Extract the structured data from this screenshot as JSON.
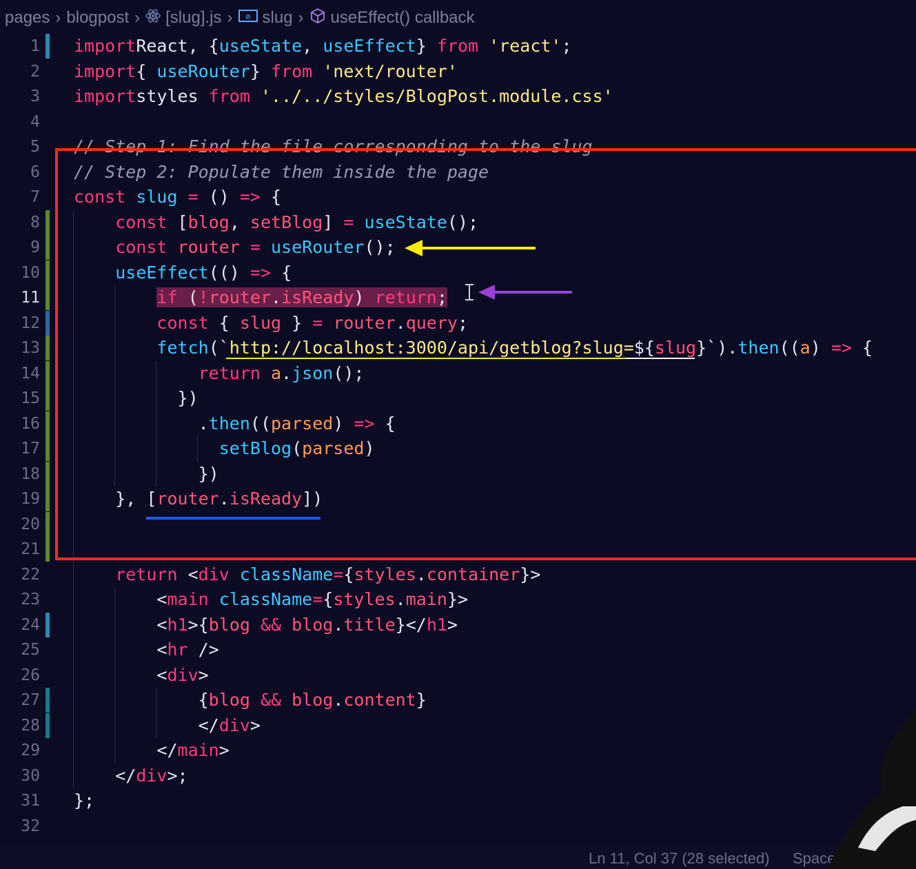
{
  "breadcrumb": {
    "items": [
      {
        "label": "pages",
        "icon": ""
      },
      {
        "label": "blogpost",
        "icon": ""
      },
      {
        "label": "[slug].js",
        "icon": "react-icon"
      },
      {
        "label": "slug",
        "icon": "variable-icon"
      },
      {
        "label": "useEffect() callback",
        "icon": "cube-icon"
      }
    ]
  },
  "editor": {
    "active_line": 11,
    "lines": [
      {
        "n": "1",
        "segs": [
          [
            "kw",
            "import"
          ],
          [
            "",
            "React, {"
          ],
          [
            "fn",
            "useState"
          ],
          [
            "",
            ", "
          ],
          [
            "fn",
            "useEffect"
          ],
          [
            "",
            "} "
          ],
          [
            "kw",
            "from"
          ],
          [
            "",
            ""
          ],
          [
            "str",
            " 'react'"
          ],
          [
            "",
            ";"
          ]
        ]
      },
      {
        "n": "2",
        "segs": [
          [
            "kw",
            "import"
          ],
          [
            "",
            ""
          ],
          [
            "",
            ""
          ],
          [
            "",
            ""
          ],
          [
            "",
            "{ "
          ],
          [
            "fn",
            "useRouter"
          ],
          [
            "",
            ""
          ],
          [
            "",
            ""
          ],
          [
            "",
            "} "
          ],
          [
            "kw",
            "from"
          ],
          [
            "str",
            " 'next/router'"
          ]
        ]
      },
      {
        "n": "3",
        "segs": [
          [
            "kw",
            "import"
          ],
          [
            "",
            ""
          ],
          [
            "",
            "styles "
          ],
          [
            "kw",
            "from"
          ],
          [
            "str",
            " '../../styles/BlogPost.module.css'"
          ]
        ]
      },
      {
        "n": "4",
        "segs": []
      },
      {
        "n": "5",
        "segs": [
          [
            "cm",
            "// Step 1: Find the file corresponding to the slug"
          ]
        ]
      },
      {
        "n": "6",
        "segs": [
          [
            "cm",
            "// Step 2: Populate them inside the page"
          ]
        ]
      },
      {
        "n": "7",
        "segs": [
          [
            "kw",
            "const"
          ],
          [
            "fn",
            " slug"
          ],
          [
            "kw",
            " ="
          ],
          [
            "",
            " () "
          ],
          [
            "kw",
            "=>"
          ],
          [
            "",
            " {"
          ]
        ]
      },
      {
        "n": "8",
        "segs": [
          [
            "",
            "    "
          ],
          [
            "kw",
            "const"
          ],
          [
            "",
            " ["
          ],
          [
            "var",
            "blog"
          ],
          [
            "",
            ", "
          ],
          [
            "var",
            "setBlog"
          ],
          [
            "",
            "] "
          ],
          [
            "kw",
            "="
          ],
          [
            "fn",
            " useState"
          ],
          [
            "",
            "();"
          ]
        ]
      },
      {
        "n": "9",
        "segs": [
          [
            "",
            "    "
          ],
          [
            "kw",
            "const"
          ],
          [
            "var",
            " router"
          ],
          [
            "kw",
            " ="
          ],
          [
            "fn",
            " useRouter"
          ],
          [
            "",
            "();"
          ]
        ]
      },
      {
        "n": "10",
        "segs": [
          [
            "",
            "    "
          ],
          [
            "fn",
            "useEffect"
          ],
          [
            "",
            "(() "
          ],
          [
            "kw",
            "=>"
          ],
          [
            "",
            " {"
          ]
        ]
      },
      {
        "n": "11",
        "segs": [
          [
            "",
            "        "
          ],
          [
            "kw sel",
            "if"
          ],
          [
            "sel",
            " ("
          ],
          [
            "kw sel",
            "!"
          ],
          [
            "var sel",
            "router"
          ],
          [
            "sel",
            "."
          ],
          [
            "var sel",
            "isReady"
          ],
          [
            "sel",
            ") "
          ],
          [
            "kw sel",
            "return"
          ],
          [
            "sel",
            ";"
          ]
        ]
      },
      {
        "n": "12",
        "segs": [
          [
            "",
            "        "
          ],
          [
            "kw",
            "const"
          ],
          [
            "",
            " { "
          ],
          [
            "var",
            "slug"
          ],
          [
            "",
            " } "
          ],
          [
            "kw",
            "="
          ],
          [
            "var",
            " router"
          ],
          [
            "",
            "."
          ],
          [
            "var",
            "query"
          ],
          [
            "",
            ";"
          ]
        ]
      },
      {
        "n": "13",
        "segs": [
          [
            "",
            "        "
          ],
          [
            "fn",
            "fetch"
          ],
          [
            "",
            "(`"
          ],
          [
            "str",
            "http://localhost:3000/api/getblog?slug="
          ],
          [
            "",
            "${"
          ],
          [
            "var",
            "slug"
          ],
          [
            "",
            "}`)."
          ],
          [
            "fn",
            "then"
          ],
          [
            "",
            "(("
          ],
          [
            "param",
            "a"
          ],
          [
            "",
            ") "
          ],
          [
            "kw",
            "=>"
          ],
          [
            "",
            " {"
          ]
        ]
      },
      {
        "n": "14",
        "segs": [
          [
            "",
            "            "
          ],
          [
            "kw",
            "return"
          ],
          [
            "param",
            " a"
          ],
          [
            "",
            "."
          ],
          [
            "fn",
            "json"
          ],
          [
            "",
            "();"
          ]
        ]
      },
      {
        "n": "15",
        "segs": [
          [
            "",
            "          })"
          ]
        ]
      },
      {
        "n": "16",
        "segs": [
          [
            "",
            "            ."
          ],
          [
            "fn",
            "then"
          ],
          [
            "",
            "(("
          ],
          [
            "param",
            "parsed"
          ],
          [
            "",
            ") "
          ],
          [
            "kw",
            "=>"
          ],
          [
            "",
            " {"
          ]
        ]
      },
      {
        "n": "17",
        "segs": [
          [
            "",
            "              "
          ],
          [
            "fn",
            "setBlog"
          ],
          [
            "",
            "("
          ],
          [
            "param",
            "parsed"
          ],
          [
            "",
            ")"
          ]
        ]
      },
      {
        "n": "18",
        "segs": [
          [
            "",
            "            })"
          ]
        ]
      },
      {
        "n": "19",
        "segs": [
          [
            "",
            "    }, ["
          ],
          [
            "var",
            "router"
          ],
          [
            "",
            "."
          ],
          [
            "var",
            "isReady"
          ],
          [
            "",
            "])"
          ]
        ]
      },
      {
        "n": "20",
        "segs": []
      },
      {
        "n": "21",
        "segs": []
      },
      {
        "n": "22",
        "segs": [
          [
            "",
            "    "
          ],
          [
            "kw",
            "return"
          ],
          [
            "",
            " <"
          ],
          [
            "tag",
            "div"
          ],
          [
            "attr",
            " className"
          ],
          [
            "kw",
            "="
          ],
          [
            "",
            "{"
          ],
          [
            "var",
            "styles"
          ],
          [
            "",
            "."
          ],
          [
            "var",
            "container"
          ],
          [
            "",
            "}>"
          ]
        ]
      },
      {
        "n": "23",
        "segs": [
          [
            "",
            "        <"
          ],
          [
            "tag",
            "main"
          ],
          [
            "attr",
            " className"
          ],
          [
            "kw",
            "="
          ],
          [
            "",
            "{"
          ],
          [
            "var",
            "styles"
          ],
          [
            "",
            "."
          ],
          [
            "var",
            "main"
          ],
          [
            "",
            "}>"
          ]
        ]
      },
      {
        "n": "24",
        "segs": [
          [
            "",
            "        <"
          ],
          [
            "tag",
            "h1"
          ],
          [
            "",
            ">{"
          ],
          [
            "var",
            "blog"
          ],
          [
            "kw",
            " &&"
          ],
          [
            "var",
            " blog"
          ],
          [
            "",
            "."
          ],
          [
            "var",
            "title"
          ],
          [
            "",
            "}</"
          ],
          [
            "tag",
            "h1"
          ],
          [
            "",
            ">"
          ]
        ]
      },
      {
        "n": "25",
        "segs": [
          [
            "",
            "        <"
          ],
          [
            "tag",
            "hr"
          ],
          [
            "",
            " />"
          ]
        ]
      },
      {
        "n": "26",
        "segs": [
          [
            "",
            "        <"
          ],
          [
            "tag",
            "div"
          ],
          [
            "",
            ">"
          ]
        ]
      },
      {
        "n": "27",
        "segs": [
          [
            "",
            "            {"
          ],
          [
            "var",
            "blog"
          ],
          [
            "kw",
            " &&"
          ],
          [
            "var",
            " blog"
          ],
          [
            "",
            "."
          ],
          [
            "var",
            "content"
          ],
          [
            "",
            "}"
          ]
        ]
      },
      {
        "n": "28",
        "segs": [
          [
            "",
            "            </"
          ],
          [
            "tag",
            "div"
          ],
          [
            "",
            ">"
          ]
        ]
      },
      {
        "n": "29",
        "segs": [
          [
            "",
            "        </"
          ],
          [
            "tag",
            "main"
          ],
          [
            "",
            ">"
          ]
        ]
      },
      {
        "n": "30",
        "segs": [
          [
            "",
            "    </"
          ],
          [
            "tag",
            "div"
          ],
          [
            "",
            ">;"
          ]
        ]
      },
      {
        "n": "31",
        "segs": [
          [
            "",
            "};"
          ]
        ]
      },
      {
        "n": "32",
        "segs": []
      }
    ]
  },
  "status_bar": {
    "position": "Ln 11, Col 37 (28 selected)",
    "spaces": "Spaces"
  },
  "colors": {
    "background": "#0b0b24",
    "keyword": "#ff3d7a",
    "function": "#3fc7ff",
    "string": "#ffe98a",
    "annotation_box": "#ff2a1a",
    "yellow_arrow": "#ffee00",
    "purple_arrow": "#9b3fd6",
    "blue_underline": "#1a5cff"
  }
}
